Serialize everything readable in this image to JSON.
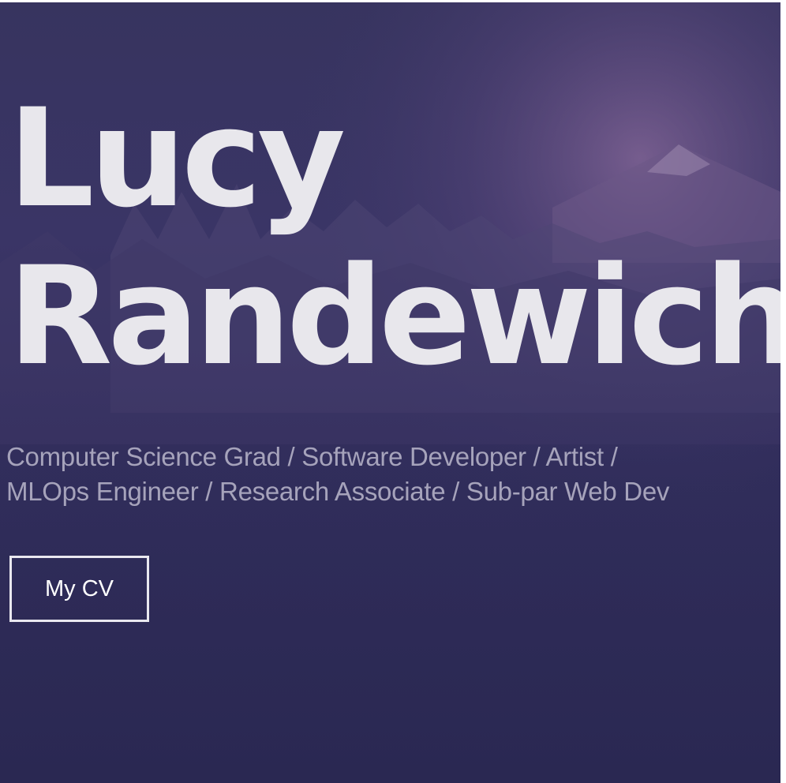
{
  "hero": {
    "name_line1": "Lucy",
    "name_line2": "Randewich.",
    "subtitle_line1": "Computer Science Grad / Software Developer / Artist /",
    "subtitle_line2": "MLOps Engineer / Research Associate / Sub-par Web Dev",
    "cv_button_label": "My CV"
  },
  "colors": {
    "background": "#332f5e",
    "name_text": "#e8e7ec",
    "subtitle_text": "#a6a3bb",
    "button_border": "#e9e8ef"
  }
}
